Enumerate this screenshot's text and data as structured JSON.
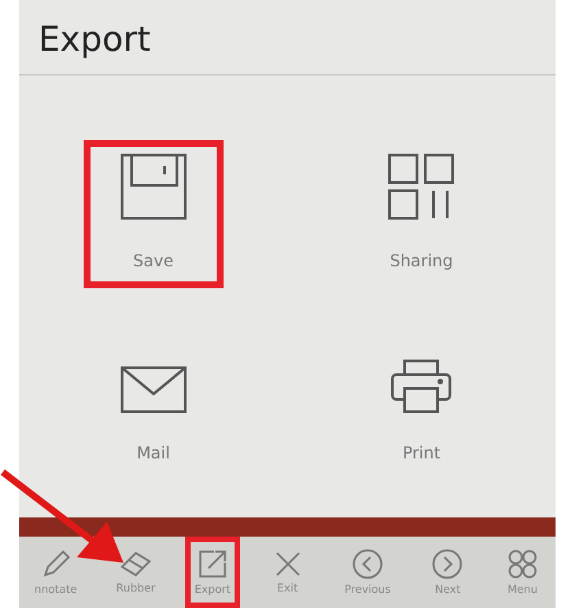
{
  "panel": {
    "title": "Export"
  },
  "tiles": [
    {
      "kind": "save",
      "label": "Save",
      "highlighted": true
    },
    {
      "kind": "sharing",
      "label": "Sharing",
      "highlighted": false
    },
    {
      "kind": "mail",
      "label": "Mail",
      "highlighted": false
    },
    {
      "kind": "print",
      "label": "Print",
      "highlighted": false
    }
  ],
  "toolbar": [
    {
      "kind": "annotate",
      "label": "nnotate",
      "highlighted": false
    },
    {
      "kind": "rubber",
      "label": "Rubber",
      "highlighted": false
    },
    {
      "kind": "export",
      "label": "Export",
      "highlighted": true
    },
    {
      "kind": "exit",
      "label": "Exit",
      "highlighted": false
    },
    {
      "kind": "previous",
      "label": "Previous",
      "highlighted": false
    },
    {
      "kind": "next",
      "label": "Next",
      "highlighted": false
    },
    {
      "kind": "menu",
      "label": "Menu",
      "highlighted": false
    }
  ],
  "annotation_arrow": {
    "shown": true
  }
}
